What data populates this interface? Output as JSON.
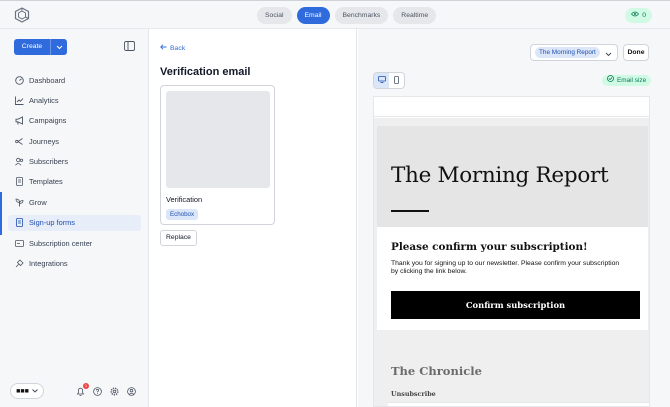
{
  "top_nav": {
    "tabs": [
      {
        "label": "Social",
        "active": false
      },
      {
        "label": "Email",
        "active": true
      },
      {
        "label": "Benchmarks",
        "active": false
      },
      {
        "label": "Realtime",
        "active": false
      }
    ],
    "viewers_count": "0"
  },
  "sidebar": {
    "create_label": "Create",
    "items": [
      {
        "label": "Dashboard",
        "icon": "dashboard-icon"
      },
      {
        "label": "Analytics",
        "icon": "analytics-icon"
      },
      {
        "label": "Campaigns",
        "icon": "megaphone-icon"
      },
      {
        "label": "Journeys",
        "icon": "journeys-icon"
      },
      {
        "label": "Subscribers",
        "icon": "users-icon"
      },
      {
        "label": "Templates",
        "icon": "templates-icon"
      },
      {
        "label": "Grow",
        "icon": "grow-icon"
      },
      {
        "label": "Sign-up forms",
        "icon": "form-icon",
        "active": true
      },
      {
        "label": "Subscription center",
        "icon": "subscription-center-icon"
      },
      {
        "label": "Integrations",
        "icon": "integrations-icon"
      }
    ],
    "notifications_count": "1"
  },
  "middle": {
    "back_label": "Back",
    "title": "Verification email",
    "form": {
      "name": "Verification",
      "tag": "Echobox"
    },
    "replace_label": "Replace"
  },
  "preview": {
    "newsletter_selected": "The Morning Report",
    "done_label": "Done",
    "size_status": "Email size",
    "email": {
      "masthead": "The Morning Report",
      "heading": "Please confirm your subscription!",
      "body": "Thank you for signing up to our newsletter. Please confirm your subscription by clicking the link below.",
      "button": "Confirm subscription",
      "footer_title": "The Chronicle",
      "unsubscribe": "Unsubscribe"
    }
  },
  "colors": {
    "accent": "#2f6bdc",
    "success_bg": "#d1fae5",
    "success_text": "#047857"
  }
}
